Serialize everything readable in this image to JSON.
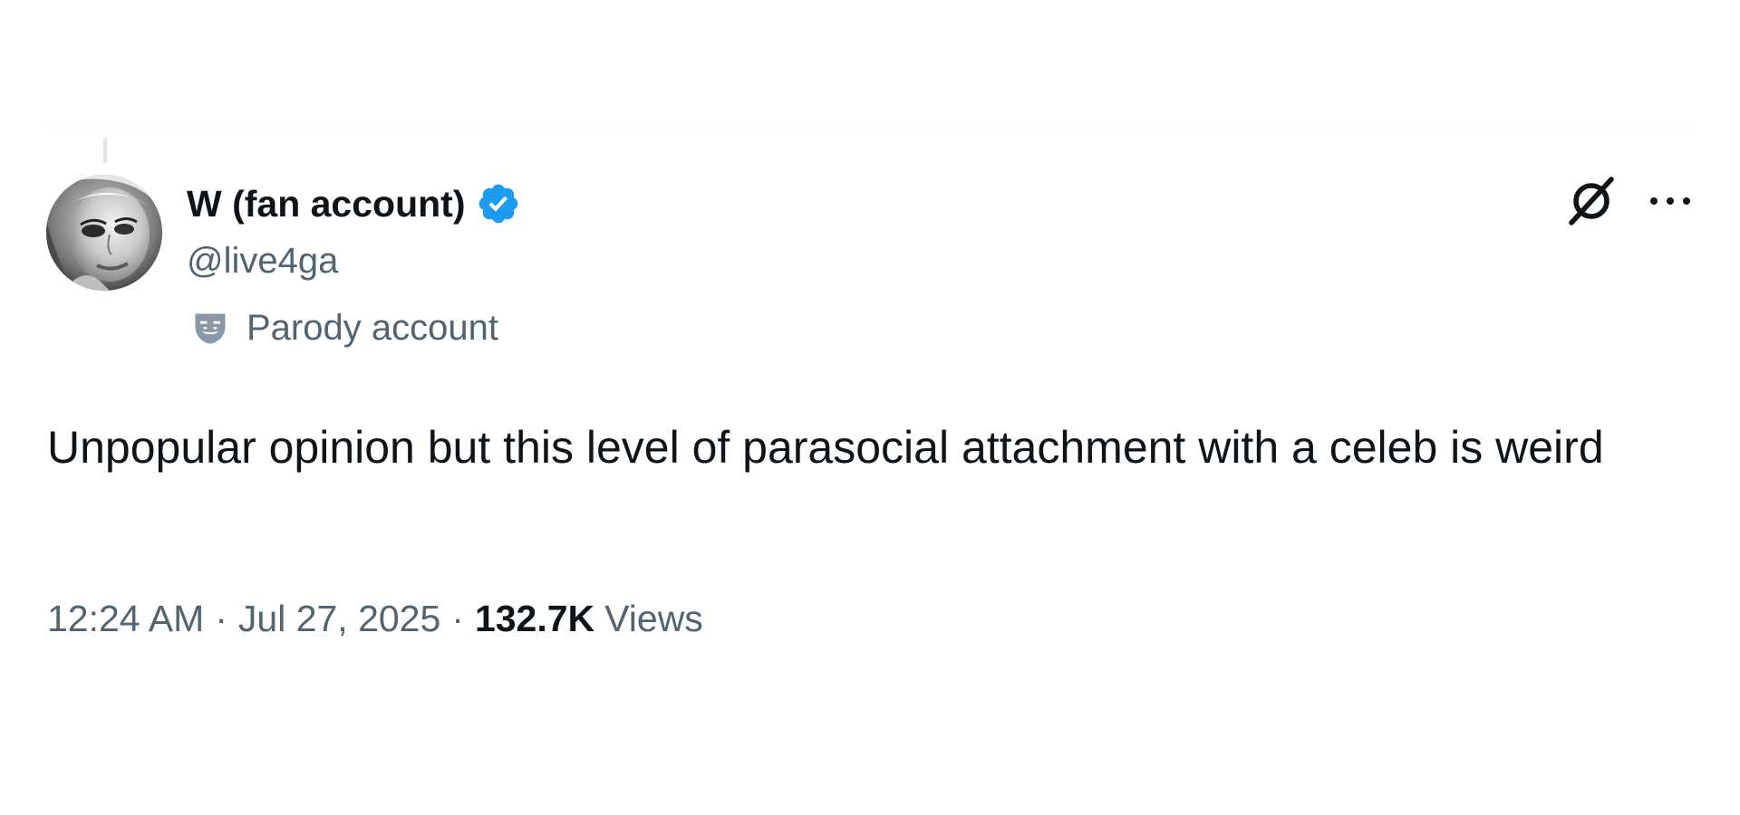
{
  "tweet": {
    "author": {
      "display_name": "W (fan account)",
      "handle": "@live4ga",
      "verified": true,
      "label": "Parody account",
      "label_icon": "parody-mask-icon"
    },
    "text": "Unpopular opinion but this level of parasocial attachment with a celeb is weird",
    "time": "12:24 AM",
    "separator": "·",
    "date": "Jul 27, 2025",
    "views_count": "132.7K",
    "views_label": "Views"
  },
  "icons": {
    "verified": "verified-badge-icon",
    "grok": "grok-icon",
    "more": "more-options-icon"
  },
  "colors": {
    "text_primary": "#0f1419",
    "text_secondary": "#536471",
    "verified_blue": "#1d9bf0",
    "background": "#ffffff"
  }
}
